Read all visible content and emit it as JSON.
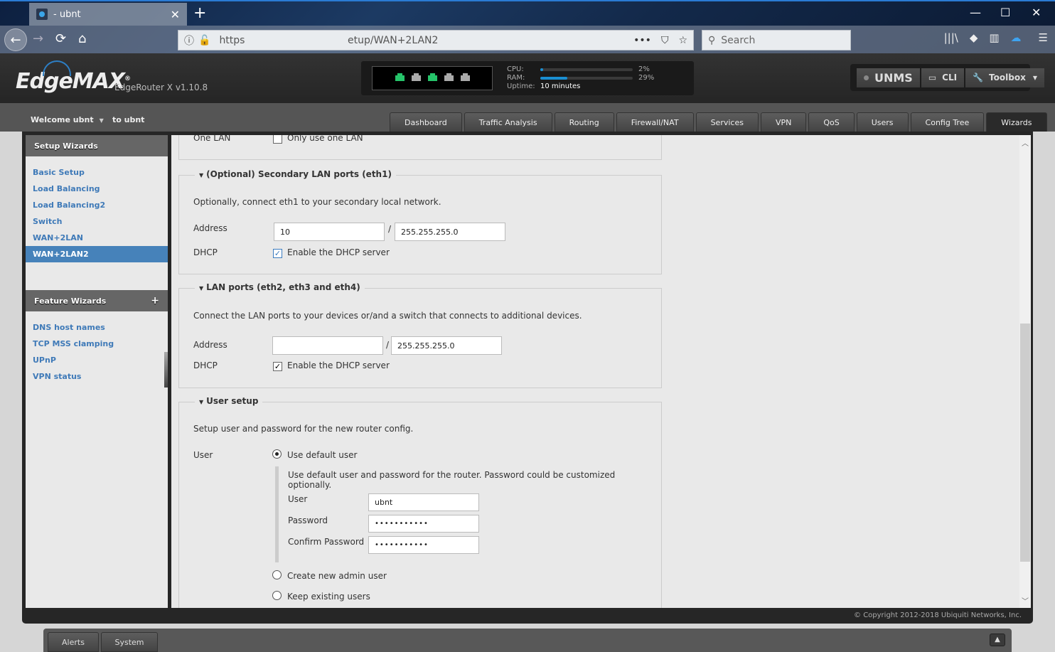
{
  "browser": {
    "tab_title": "- ubnt",
    "url_scheme": "https",
    "url_path": "etup/WAN+2LAN2",
    "search_placeholder": "Search",
    "icons": {
      "back": "←",
      "forward": "→",
      "reload": "⟳",
      "home": "⌂",
      "info": "ⓘ",
      "lock": "🔓",
      "more": "•••",
      "pocket": "⛉",
      "star": "☆",
      "search": "⚲",
      "library": "|||\\",
      "extension": "◆",
      "sidebar": "▥",
      "cloud": "☁",
      "menu": "☰",
      "close": "✕",
      "newtab": "+",
      "minimize": "—",
      "maximize": "☐",
      "winclose": "✕"
    }
  },
  "header": {
    "brand": "EdgeMAX",
    "model": "EdgeRouter X v1.10.8",
    "ports": [
      true,
      false,
      true,
      false,
      false
    ],
    "stats": {
      "cpu_label": "CPU:",
      "cpu_value": "2%",
      "cpu_fraction": 0.02,
      "ram_label": "RAM:",
      "ram_value": "29%",
      "ram_fraction": 0.29,
      "uptime_label": "Uptime:",
      "uptime_value": "10 minutes"
    },
    "tools": {
      "unms": "UNMS",
      "cli": "CLI",
      "toolbox": "Toolbox"
    }
  },
  "subheader": {
    "welcome": "Welcome ubnt",
    "to_user": "to ubnt",
    "tabs": [
      "Dashboard",
      "Traffic Analysis",
      "Routing",
      "Firewall/NAT",
      "Services",
      "VPN",
      "QoS",
      "Users",
      "Config Tree",
      "Wizards"
    ],
    "active_tab": "Wizards"
  },
  "sidebar": {
    "setup_title": "Setup Wizards",
    "setup_items": [
      "Basic Setup",
      "Load Balancing",
      "Load Balancing2",
      "Switch",
      "WAN+2LAN",
      "WAN+2LAN2"
    ],
    "active_item": "WAN+2LAN2",
    "feature_title": "Feature Wizards",
    "feature_items": [
      "DNS host names",
      "TCP MSS clamping",
      "UPnP",
      "VPN status"
    ]
  },
  "form": {
    "one_lan": {
      "label": "One LAN",
      "checkbox_label": "Only use one LAN",
      "checked": false
    },
    "secondary": {
      "legend": "(Optional) Secondary LAN ports (eth1)",
      "description": "Optionally, connect eth1 to your secondary local network.",
      "address_label": "Address",
      "address_value": "10",
      "mask_value": "255.255.255.0",
      "dhcp_label": "DHCP",
      "dhcp_checkbox": "Enable the DHCP server",
      "dhcp_checked": true
    },
    "lan": {
      "legend": "LAN ports (eth2, eth3 and eth4)",
      "description": "Connect the LAN ports to your devices or/and a switch that connects to additional devices.",
      "address_label": "Address",
      "address_value": "",
      "mask_value": "255.255.255.0",
      "dhcp_label": "DHCP",
      "dhcp_checkbox": "Enable the DHCP server",
      "dhcp_checked": true
    },
    "user": {
      "legend": "User setup",
      "description": "Setup user and password for the new router config.",
      "user_label": "User",
      "options": [
        "Use default user",
        "Create new admin user",
        "Keep existing users"
      ],
      "selected": "Use default user",
      "default_description": "Use default user and password for the router. Password could be customized optionally.",
      "field_user_label": "User",
      "field_user_value": "ubnt",
      "field_password_label": "Password",
      "field_password_value": "•••••••••••",
      "field_confirm_label": "Confirm Password",
      "field_confirm_value": "•••••••••••"
    }
  },
  "footer": {
    "copyright": "© Copyright 2012-2018 Ubiquiti Networks, Inc."
  },
  "bottom": {
    "tabs": [
      "Alerts",
      "System"
    ]
  }
}
